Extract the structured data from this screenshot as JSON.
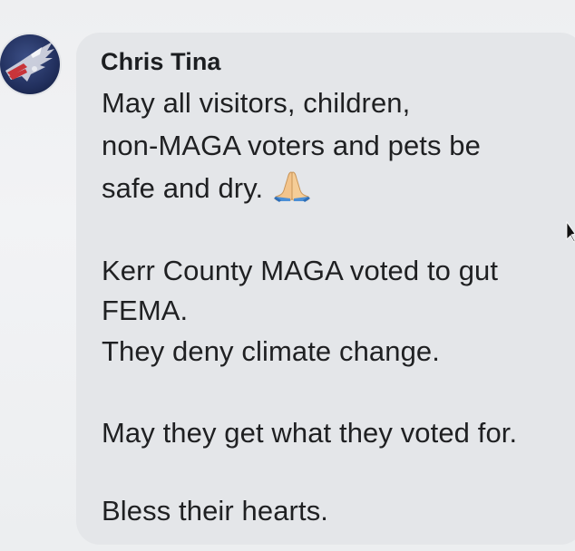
{
  "post": {
    "author": "Chris Tina",
    "lines": [
      "May all visitors, children,",
      "non-MAGA voters and pets be",
      "safe and dry.",
      "Kerr County MAGA voted to gut",
      "FEMA.",
      "They deny climate change.",
      "May they get what they voted for.",
      "Bless their hearts."
    ],
    "emoji": "folded-hands-emoji"
  },
  "colors": {
    "bubble": "#e4e6e9",
    "text": "#1f2022",
    "avatar_bg": "#22305e"
  }
}
